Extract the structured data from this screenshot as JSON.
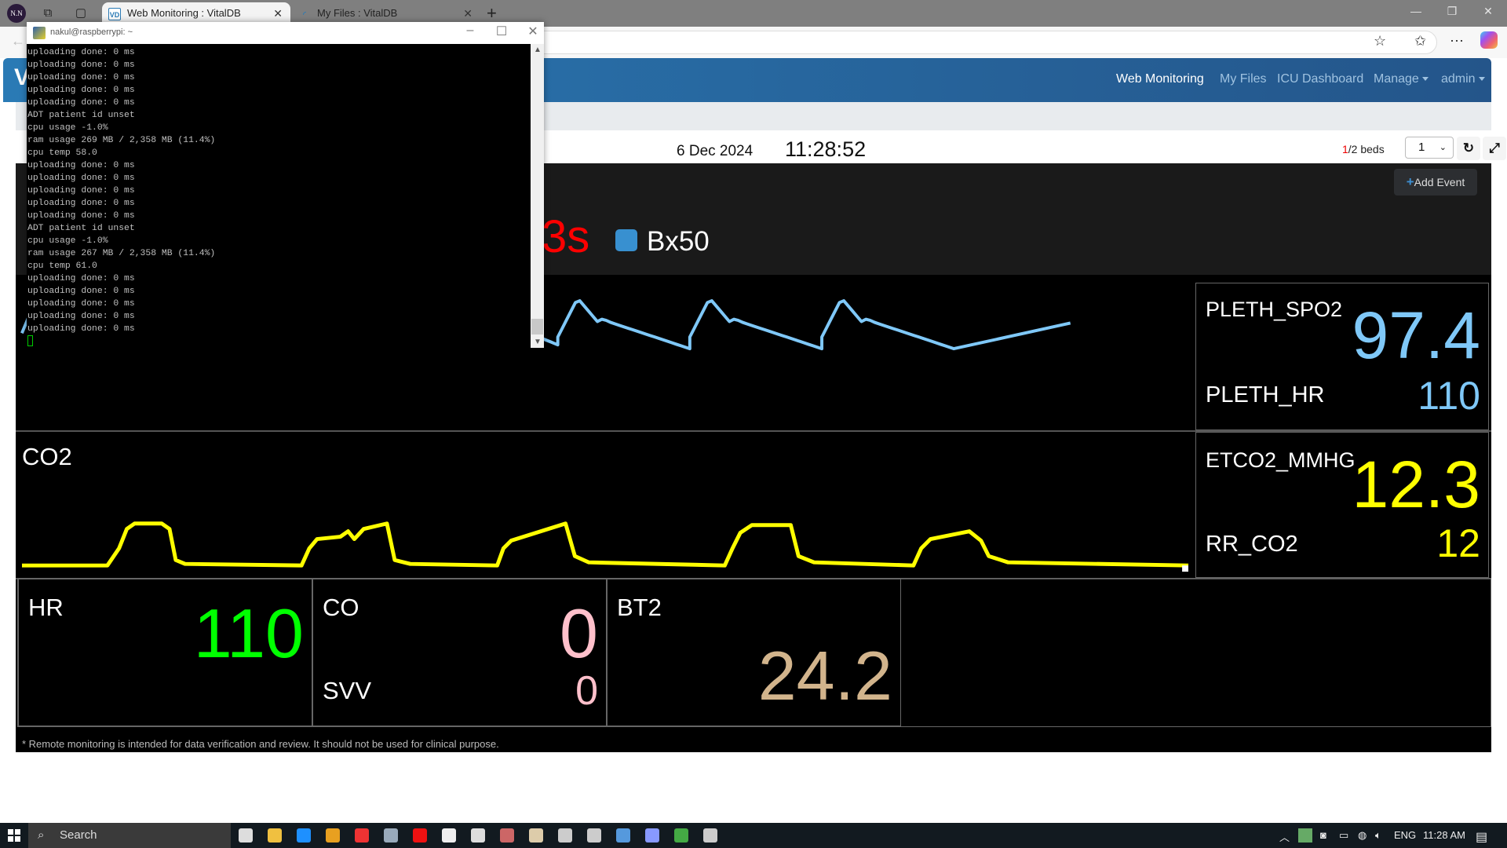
{
  "browser": {
    "profile_initials": "N.N",
    "tabs": [
      {
        "label": "Web Monitoring : VitalDB",
        "active": true,
        "favicon": "vd-logo"
      },
      {
        "label": "My Files : VitalDB",
        "active": false,
        "favicon": "loading-spinner"
      }
    ],
    "icons": [
      "workspaces-icon",
      "tab-actions-icon",
      "new-tab-icon",
      "favorite-star-icon",
      "favorites-icon",
      "more-icon",
      "copilot-icon",
      "back-icon"
    ]
  },
  "navbar": {
    "brand": "V",
    "items": [
      {
        "label": "Web Monitoring",
        "active": true
      },
      {
        "label": "My Files",
        "active": false
      },
      {
        "label": "ICU Dashboard",
        "active": false
      },
      {
        "label": "Manage",
        "active": false,
        "dropdown": true
      },
      {
        "label": "admin",
        "active": false,
        "dropdown": true
      }
    ]
  },
  "toolbar": {
    "date": "6 Dec 2024",
    "time": "11:28:52",
    "beds_current": "1",
    "beds_text": "/2 beds",
    "bed_select_value": "1",
    "refresh_icon": "refresh-icon",
    "fullscreen_icon": "expand-icon"
  },
  "monitor": {
    "add_event_label": "Add Event",
    "timer_text": "3s",
    "device_name": "Bx50",
    "device_color": "#3890d0",
    "pleth": {
      "wave_color": "#7fc8f8",
      "params": [
        {
          "label": "PLETH_SPO2",
          "value": "97.4"
        },
        {
          "label": "PLETH_HR",
          "value": "110"
        }
      ]
    },
    "co2": {
      "label": "CO2",
      "wave_color": "#ffff00",
      "params": [
        {
          "label": "ETCO2_MMHG",
          "value": "12.3"
        },
        {
          "label": "RR_CO2",
          "value": "12"
        }
      ]
    },
    "boxes": [
      {
        "label": "HR",
        "value": "110",
        "color": "#00ff00"
      },
      {
        "label": "CO",
        "value": "0",
        "sub_label": "SVV",
        "sub_value": "0",
        "color": "#ffc0cb"
      },
      {
        "label": "BT2",
        "value": "24.2",
        "color": "#d2b48c"
      }
    ],
    "disclaimer": "* Remote monitoring is intended for data verification and review. It should not be used for clinical purpose."
  },
  "terminal": {
    "title": "nakul@raspberrypi: ~",
    "lines": [
      "uploading done: 0 ms",
      "uploading done: 0 ms",
      "uploading done: 0 ms",
      "uploading done: 0 ms",
      "uploading done: 0 ms",
      "ADT patient id unset",
      "cpu usage -1.0%",
      "ram usage 269 MB / 2,358 MB (11.4%)",
      "cpu temp 58.0",
      "uploading done: 0 ms",
      "uploading done: 0 ms",
      "uploading done: 0 ms",
      "uploading done: 0 ms",
      "uploading done: 0 ms",
      "ADT patient id unset",
      "cpu usage -1.0%",
      "ram usage 267 MB / 2,358 MB (11.4%)",
      "cpu temp 61.0",
      "uploading done: 0 ms",
      "uploading done: 0 ms",
      "uploading done: 0 ms",
      "uploading done: 0 ms",
      "uploading done: 0 ms"
    ]
  },
  "taskbar": {
    "search_label": "Search",
    "language": "ENG",
    "clock": "11:28 AM",
    "apps": [
      "task-view",
      "file-explorer",
      "edge",
      "chrome",
      "vivaldi",
      "app-5",
      "opera",
      "notepad",
      "app-8",
      "app-9",
      "putty",
      "calculator",
      "app-12",
      "keyboard",
      "app-14",
      "vnc",
      "terminal"
    ]
  }
}
